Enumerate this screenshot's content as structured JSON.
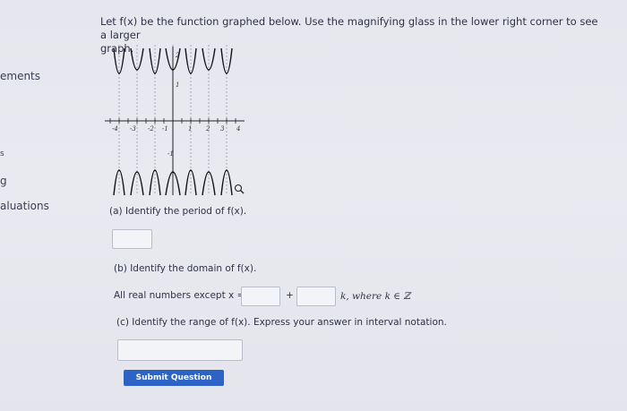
{
  "sidebar": {
    "items": [
      {
        "label": "ements",
        "top": 0
      },
      {
        "label": "s",
        "top": 0
      },
      {
        "label": "g",
        "top": 0
      },
      {
        "label": "aluations",
        "top": 0
      }
    ]
  },
  "question": {
    "prompt_line1": "Let f(x) be the function graphed below. Use the magnifying glass in the lower right corner to see a larger",
    "prompt_line2": "graph.",
    "graph": {
      "x_ticks": [
        "-4",
        "-3",
        "-2",
        "-1",
        "1",
        "2",
        "3",
        "4"
      ],
      "y_labels": [
        "2",
        "1",
        "-1"
      ],
      "magnify_icon": "magnifying-glass-icon"
    },
    "part_a": "(a) Identify the period of f(x).",
    "part_b": "(b) Identify the domain of f(x).",
    "domain_prefix": "All real numbers except x =",
    "domain_plus": "+",
    "domain_suffix": "k, where k ∈ ℤ",
    "part_c": "(c) Identify the range of f(x). Express your answer in interval notation.",
    "submit_label": "Submit Question"
  }
}
